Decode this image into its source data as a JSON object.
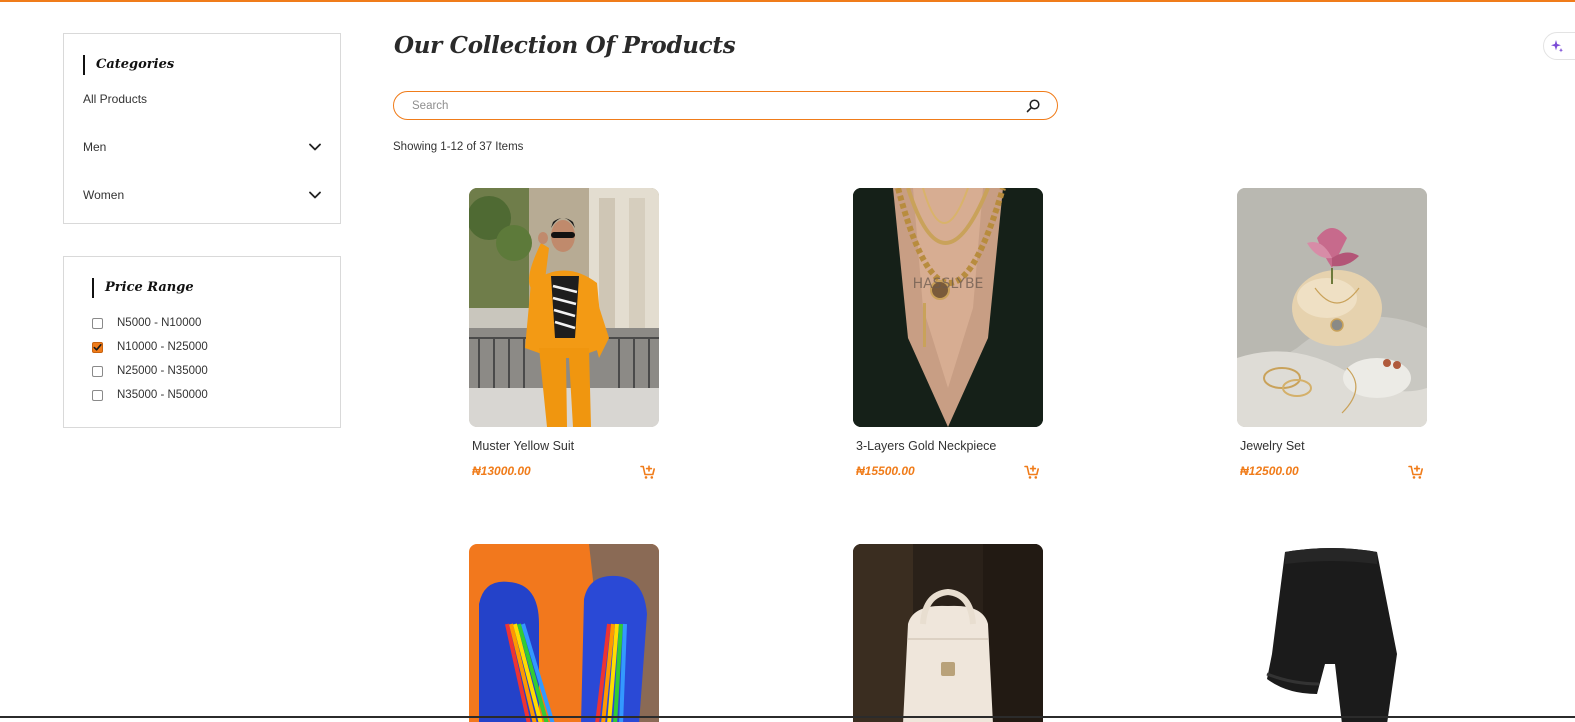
{
  "sidebar": {
    "categories": {
      "title": "Categories",
      "items": [
        {
          "label": "All Products"
        },
        {
          "label": "Men"
        },
        {
          "label": "Women"
        }
      ]
    },
    "price_range": {
      "title": "Price Range",
      "options": [
        {
          "label": "N5000 - N10000",
          "checked": false
        },
        {
          "label": "N10000 - N25000",
          "checked": true
        },
        {
          "label": "N25000 - N35000",
          "checked": false
        },
        {
          "label": "N35000 - N50000",
          "checked": false
        }
      ]
    }
  },
  "main": {
    "title": "Our Collection Of Products",
    "search": {
      "placeholder": "Search",
      "value": ""
    },
    "count_text": "Showing 1-12 of 37 Items",
    "products": [
      {
        "name": "Muster Yellow Suit",
        "price": "₦13000.00"
      },
      {
        "name": "3-Layers Gold Neckpiece",
        "price": "₦15500.00"
      },
      {
        "name": "Jewelry Set",
        "price": "₦12500.00"
      },
      {
        "name": "",
        "price": ""
      },
      {
        "name": "",
        "price": ""
      },
      {
        "name": "",
        "price": ""
      }
    ]
  },
  "colors": {
    "accent": "#f07c1a",
    "border": "#d9d9d9",
    "text": "#333333"
  },
  "icons": [
    "chevron-down-icon",
    "search-icon",
    "add-to-cart-icon",
    "sparkle-icon",
    "check-icon"
  ]
}
